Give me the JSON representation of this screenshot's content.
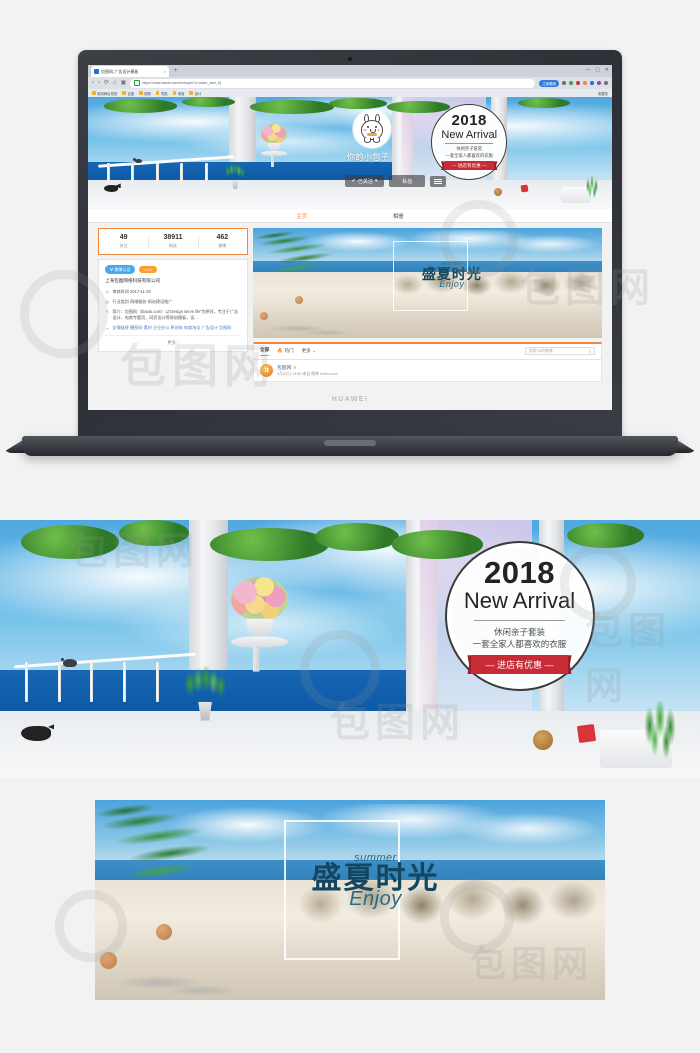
{
  "browser": {
    "tab_title": "包图网-广告设计模板",
    "tab_close": "×",
    "new_tab": "+",
    "url": "https://www.baotu.com/v/zhuye/?c=nown_zsrv_bj",
    "nav_back": "‹",
    "nav_forward": "›",
    "nav_reload": "⟳",
    "nav_home": "⌂",
    "nav_shield": "▣",
    "translate_pill": "立即翻译",
    "window_min": "—",
    "window_max": "▢",
    "window_close": "✕",
    "bookmarks": [
      {
        "label": "常用网址导航"
      },
      {
        "label": "百度"
      },
      {
        "label": "视频"
      },
      {
        "label": "导航"
      },
      {
        "label": "淘宝"
      },
      {
        "label": "设计"
      }
    ],
    "bookmarks_right": "收藏夹"
  },
  "hero": {
    "nickname": "你的小包子",
    "follow_button": "已关注",
    "follow_caret": "▾",
    "follow_check": "✔",
    "message_button": "私信",
    "more_button": "menu",
    "badge": {
      "year": "2018",
      "title": "New Arrival",
      "sub_line1": "休闲亲子套装",
      "sub_line2": "一套全家人都喜欢的衣服",
      "ribbon": "— 进店有优惠 —"
    }
  },
  "nav": {
    "tabs": [
      {
        "label": "主页",
        "active": true
      },
      {
        "label": "相册",
        "active": false
      }
    ]
  },
  "stats": [
    {
      "value": "49",
      "label": "关注"
    },
    {
      "value": "38911",
      "label": "粉丝"
    },
    {
      "value": "462",
      "label": "微博"
    }
  ],
  "verify": {
    "badge_weibo": "微博认证",
    "badge_weibo_icon": "V",
    "badge_level": "Lv.8",
    "company": "上海包图网络科技有限公司",
    "rows": [
      {
        "icon": "◎",
        "label": "审核时间",
        "text": "审核时间 2017-11-29"
      },
      {
        "icon": "▤",
        "label": "行业类别",
        "text": "行业类别 网络服务-网站建设推广"
      },
      {
        "icon": "✎",
        "label": "简介",
        "text": "简介：包图网（ibaotu.com）以'Design serve life'为原则，专注于广告设计、电商专题页、网页设计等原创模板，设..."
      },
      {
        "icon": "∞",
        "label": "友情链接",
        "text": "友情链接 摄图网·素材 企业办公 原创体 电商淘宝 广告设计 包图网"
      }
    ],
    "more": "更多 ›"
  },
  "summer_banner": {
    "summer_script": "summer",
    "main_title": "盛夏时光",
    "enjoy_script": "Enjoy"
  },
  "feedbar": {
    "tabs": [
      {
        "label": "全部",
        "active": true
      },
      {
        "label": "热门",
        "active": false,
        "hot": true
      },
      {
        "label": "更多",
        "active": false,
        "caret": "⌄"
      }
    ],
    "search_placeholder": "搜索TA的微博",
    "search_icon": "🔍"
  },
  "post": {
    "avatar_letter": "b",
    "author": "包图网",
    "verified_icon": "V",
    "meta": "3月23日 13:55 来自 微博 weibo.com"
  },
  "laptop": {
    "brand": "HUAWEI"
  },
  "watermarks": {
    "text": "包图网",
    "logo": "6"
  },
  "colors": {
    "accent_orange": "#f0873a",
    "ribbon_red": "#c62b36",
    "weibo_blue": "#4aa8e8",
    "page_bg": "#f2f2f2"
  }
}
